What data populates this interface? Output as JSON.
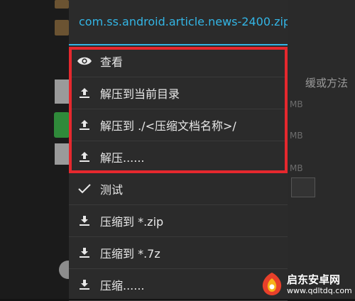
{
  "dialog": {
    "title": "com.ss.android.article.news-2400.zip",
    "accent_color": "#33b5e5",
    "items": [
      {
        "label": "查看",
        "icon": "eye-icon"
      },
      {
        "label": "解压到当前目录",
        "icon": "upload-icon"
      },
      {
        "label": "解压到 ./<压缩文档名称>/",
        "icon": "upload-icon"
      },
      {
        "label": "解压......",
        "icon": "upload-icon"
      },
      {
        "label": "测试",
        "icon": "check-icon"
      },
      {
        "label": "压缩到 *.zip",
        "icon": "download-icon"
      },
      {
        "label": "压缩到 *.7z",
        "icon": "download-icon"
      },
      {
        "label": "压缩......",
        "icon": "download-icon"
      }
    ]
  },
  "highlight_color": "#e5282e",
  "background": {
    "side_text_1": "缓或方法",
    "size_1": "MB",
    "size_2": "MB",
    "size_3": "MB"
  },
  "watermark": {
    "name": "启东安卓网",
    "url": "www.qdltdq.com"
  }
}
